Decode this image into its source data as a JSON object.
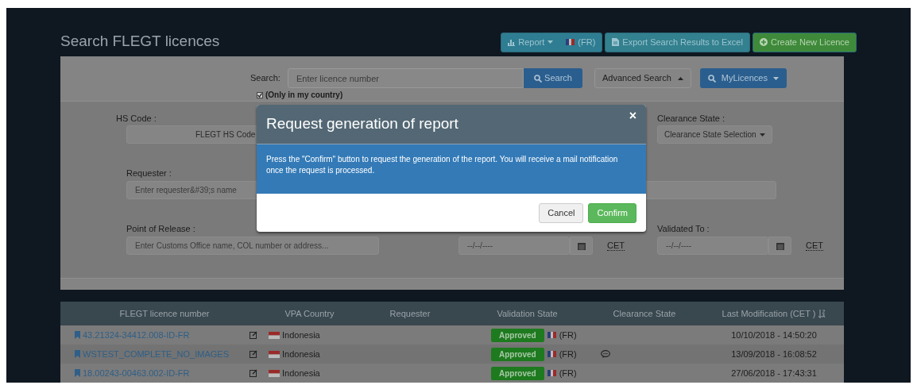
{
  "title": "Search FLEGT licences",
  "header_buttons": [
    {
      "kind": "report",
      "label": "Report",
      "suffix": "(FR)"
    },
    {
      "kind": "export",
      "label": "Export Search Results to Excel"
    },
    {
      "kind": "create",
      "label": "Create New Licence"
    }
  ],
  "search": {
    "label": "Search:",
    "placeholder": "Enter licence number",
    "button": "Search",
    "only_my_country": {
      "label": "(Only in my country)",
      "checked": true
    },
    "advanced_search": "Advanced Search",
    "my_licences": "MyLicences"
  },
  "filters": {
    "hs_code": {
      "label": "HS Code :",
      "button": "FLEGT HS Code"
    },
    "clearance_state": {
      "label": "Clearance State :",
      "button": "Clearance State Selection"
    },
    "requester": {
      "label": "Requester :",
      "placeholder": "Enter requester&#39;s name"
    },
    "point_of_release": {
      "label": "Point of Release :",
      "placeholder": "Enter Customs Office name, COL number or address..."
    },
    "validated_from": {
      "placeholder": "--/--/----",
      "timezone": "CET"
    },
    "validated_to": {
      "label": "Validated To :",
      "placeholder": "--/--/----",
      "timezone": "CET"
    }
  },
  "table": {
    "columns": [
      "FLEGT licence number",
      "VPA Country",
      "Requester",
      "Validation State",
      "Clearance State",
      "Last Modification (CET )"
    ],
    "rows": [
      {
        "number": "43.21324-34412.008-ID-FR",
        "country": "Indonesia",
        "validation_state": "Approved",
        "validation_country": "(FR)",
        "has_comment": false,
        "last_modified": "10/10/2018 - 14:50:20"
      },
      {
        "number": "WSTEST_COMPLETE_NO_IMAGES",
        "country": "Indonesia",
        "validation_state": "Approved",
        "validation_country": "(FR)",
        "has_comment": true,
        "last_modified": "13/09/2018 - 16:08:52"
      },
      {
        "number": "18.00243-00463.002-ID-FR",
        "country": "Indonesia",
        "validation_state": "Approved",
        "validation_country": "(FR)",
        "has_comment": false,
        "last_modified": "27/06/2018 - 17:43:31"
      }
    ]
  },
  "modal": {
    "title": "Request generation of report",
    "close": "×",
    "message": "Press the \"Confirm\" button to request the generation of the report. You will receive a mail notification once the request is processed.",
    "buttons": [
      {
        "kind": "cancel",
        "label": "Cancel"
      },
      {
        "kind": "confirm",
        "label": "Confirm"
      }
    ]
  }
}
